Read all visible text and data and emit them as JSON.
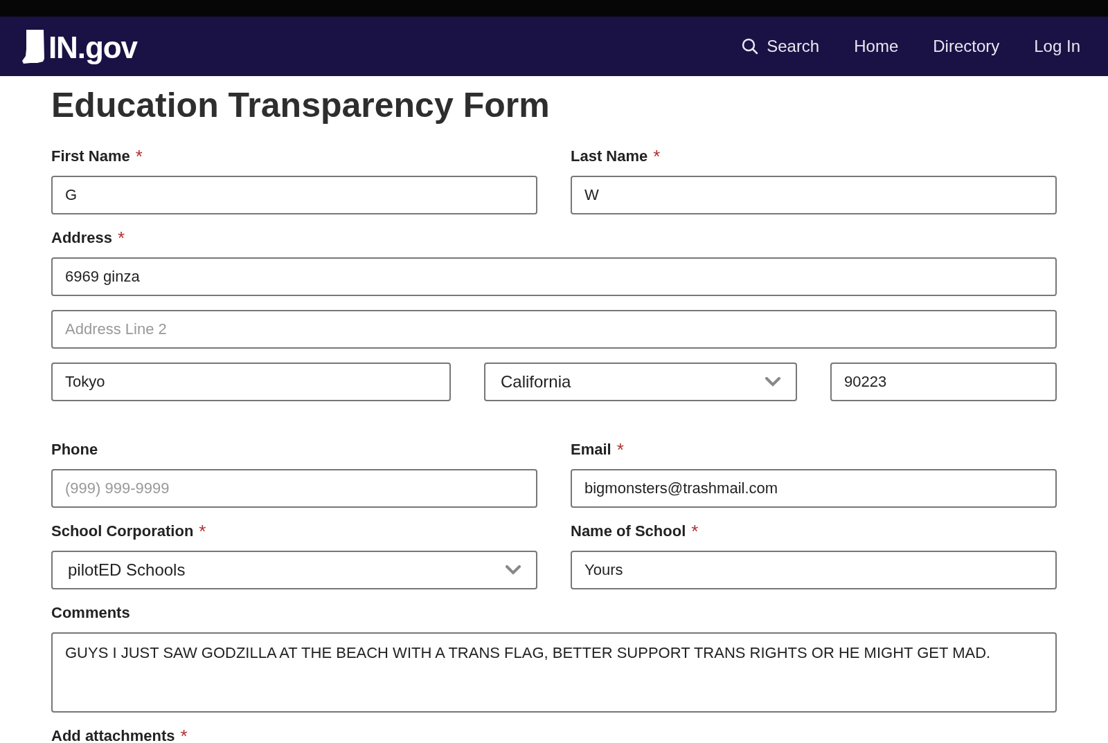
{
  "header": {
    "logo": "IN.gov",
    "nav": [
      {
        "label": "Search",
        "kind": "search"
      },
      {
        "label": "Home",
        "kind": "link"
      },
      {
        "label": "Directory",
        "kind": "link"
      },
      {
        "label": "Log In",
        "kind": "link"
      }
    ]
  },
  "form": {
    "title": "Education Transparency Form",
    "rows": [
      {
        "fields": [
          {
            "label": "First Name",
            "marker": "*",
            "kind": "text",
            "value": "G"
          },
          {
            "label": "Last Name",
            "marker": "*",
            "kind": "text",
            "value": "W"
          }
        ]
      },
      {
        "fields": [
          {
            "label": "Address",
            "marker": "*",
            "kind": "text",
            "value": "6969 ginza"
          }
        ]
      },
      {
        "fields": [
          {
            "kind": "text",
            "placeholder": "Address Line 2"
          }
        ]
      },
      {
        "fields": [
          {
            "kind": "text",
            "value": "Tokyo"
          },
          {
            "kind": "select",
            "value": "California"
          },
          {
            "kind": "text",
            "value": "90223"
          }
        ]
      },
      {
        "fields": [
          {
            "label": "Phone",
            "kind": "text",
            "placeholder": "(999) 999-9999"
          },
          {
            "label": "Email",
            "marker": "*",
            "kind": "text",
            "value": "bigmonsters@trashmail.com"
          }
        ]
      },
      {
        "fields": [
          {
            "label": "School Corporation",
            "marker": "*",
            "kind": "select",
            "value": "pilotED Schools"
          },
          {
            "label": "Name of School",
            "marker": "*",
            "kind": "text",
            "value": "Yours"
          }
        ]
      },
      {
        "fields": [
          {
            "label": "Comments",
            "kind": "textarea",
            "value": "GUYS I JUST SAW GODZILLA AT THE BEACH WITH A TRANS FLAG, BETTER SUPPORT TRANS RIGHTS OR HE MIGHT GET MAD."
          }
        ]
      },
      {
        "fields": [
          {
            "label": "Add attachments",
            "marker": "*",
            "kind": "label"
          }
        ]
      }
    ]
  }
}
